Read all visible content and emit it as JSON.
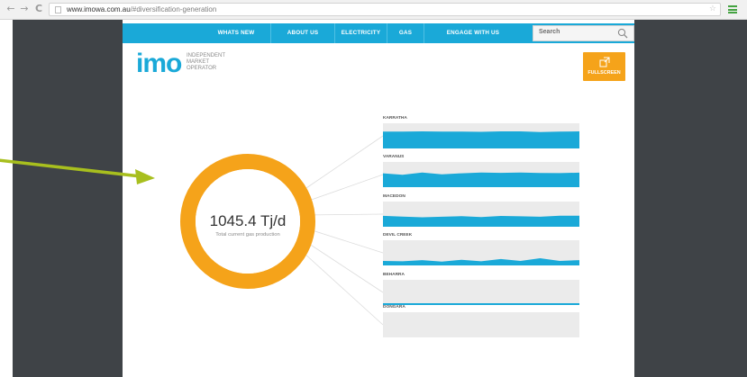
{
  "browser": {
    "url_domain": "www.imowa.com.au",
    "url_rest": "/#diversification-generation",
    "back_glyph": "←",
    "forward_glyph": "→",
    "reload_glyph": "C",
    "star_glyph": "☆"
  },
  "nav": {
    "items": [
      "WHATS NEW",
      "ABOUT US",
      "ELECTRICITY",
      "GAS",
      "ENGAGE WITH US"
    ],
    "search_placeholder": "Search"
  },
  "logo": {
    "mark": "imo",
    "text": "INDEPENDENT MARKET OPERATOR"
  },
  "fullscreen": {
    "label": "FULLSCREEN"
  },
  "donut": {
    "value": "1045.4 Tj/d",
    "caption": "Total current gas production",
    "color": "#f5a31a"
  },
  "producers": [
    {
      "name": "KARRATHA",
      "level": 0.68,
      "profile": [
        0.98,
        0.99,
        1.0,
        0.98,
        0.99,
        0.97,
        1.0,
        1.0,
        0.96,
        0.98,
        1.0
      ]
    },
    {
      "name": "VARANUS",
      "level": 0.58,
      "profile": [
        0.95,
        0.85,
        1.0,
        0.88,
        0.95,
        1.0,
        0.98,
        1.0,
        0.97,
        0.96,
        0.99
      ]
    },
    {
      "name": "MACEDON",
      "level": 0.44,
      "profile": [
        0.98,
        0.92,
        0.85,
        0.9,
        0.95,
        0.88,
        0.97,
        0.94,
        0.9,
        1.0,
        1.0
      ]
    },
    {
      "name": "DEVIL CREEK",
      "level": 0.3,
      "profile": [
        0.6,
        0.55,
        0.7,
        0.5,
        0.75,
        0.55,
        0.85,
        0.6,
        0.95,
        0.6,
        0.7
      ]
    },
    {
      "name": "BEHARRA",
      "level": 0.08,
      "profile": [
        0.9,
        0.9,
        0.9,
        0.9,
        0.9,
        0.9,
        0.9,
        0.9,
        0.9,
        0.9,
        0.9
      ]
    },
    {
      "name": "DONGARA",
      "level": 0.0,
      "profile": [
        0,
        0,
        0,
        0,
        0,
        0,
        0,
        0,
        0,
        0,
        0
      ]
    }
  ],
  "colors": {
    "nav_blue": "#1aa9d8",
    "area_blue": "#1aa9d8",
    "panel_gray": "#ebebeb",
    "accent_orange": "#f5a31a",
    "annotation_arrow": "#a8bf1e",
    "page_background": "#3f4347"
  }
}
